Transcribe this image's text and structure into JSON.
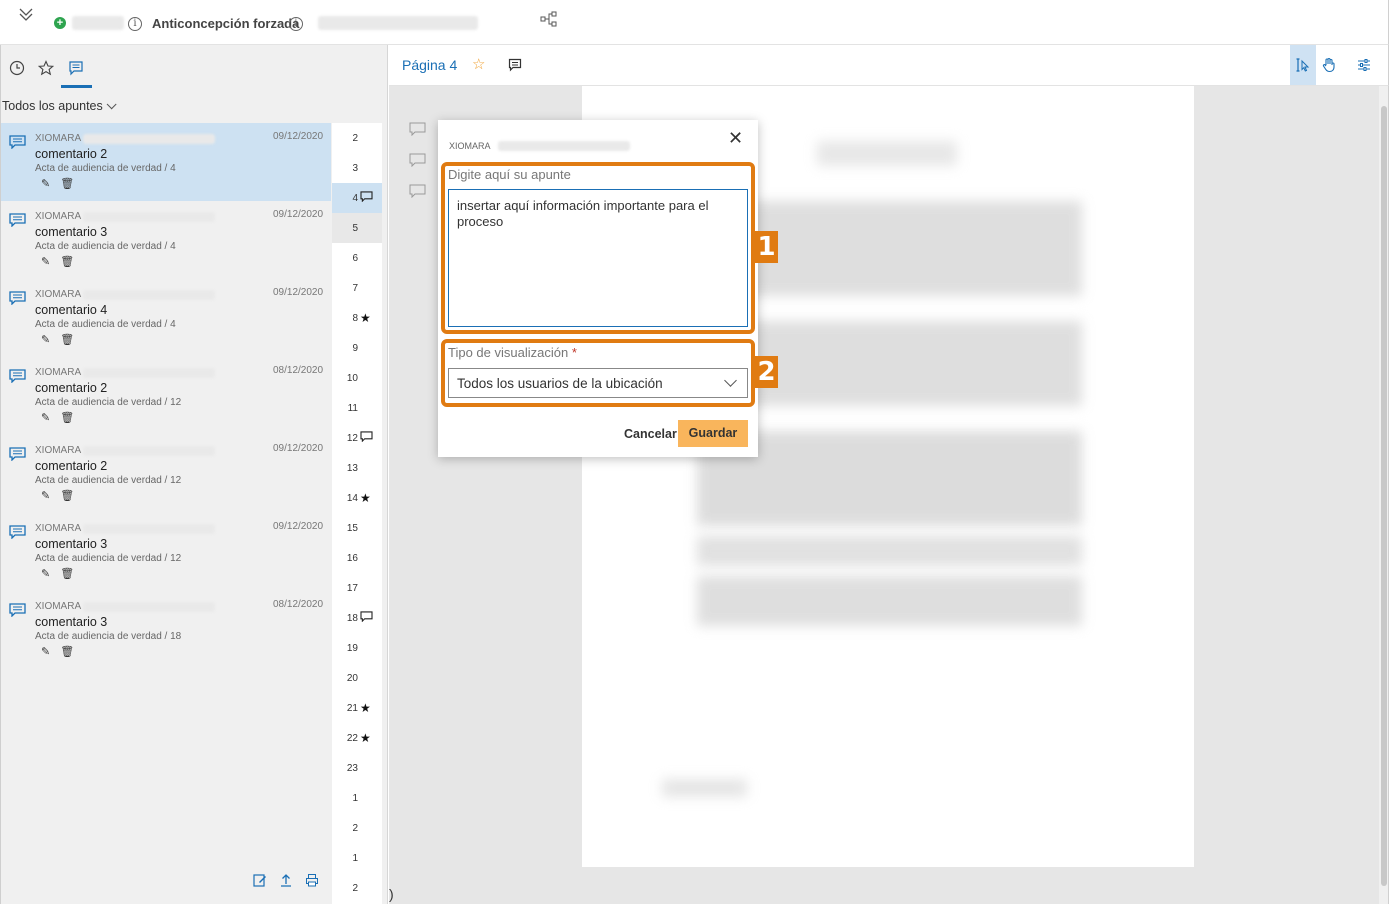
{
  "topbar": {
    "title": "Anticoncepción forzada",
    "info_glyph": "i"
  },
  "left_panel": {
    "filter_label": "Todos los apuntes",
    "notes": [
      {
        "user": "XIOMARA",
        "date": "09/12/2020",
        "title": "comentario 2",
        "doc": "Acta de audiencia de verdad / 4"
      },
      {
        "user": "XIOMARA",
        "date": "09/12/2020",
        "title": "comentario 3",
        "doc": "Acta de audiencia de verdad / 4"
      },
      {
        "user": "XIOMARA",
        "date": "09/12/2020",
        "title": "comentario 4",
        "doc": "Acta de audiencia de verdad / 4"
      },
      {
        "user": "XIOMARA",
        "date": "08/12/2020",
        "title": "comentario 2",
        "doc": "Acta de audiencia de verdad / 12"
      },
      {
        "user": "XIOMARA",
        "date": "09/12/2020",
        "title": "comentario 2",
        "doc": "Acta de audiencia de verdad / 12"
      },
      {
        "user": "XIOMARA",
        "date": "09/12/2020",
        "title": "comentario 3",
        "doc": "Acta de audiencia de verdad / 12"
      },
      {
        "user": "XIOMARA",
        "date": "08/12/2020",
        "title": "comentario 3",
        "doc": "Acta de audiencia de verdad / 18"
      }
    ],
    "pages": [
      {
        "n": "2",
        "mark": ""
      },
      {
        "n": "3",
        "mark": ""
      },
      {
        "n": "4",
        "mark": "comment"
      },
      {
        "n": "5",
        "mark": ""
      },
      {
        "n": "6",
        "mark": ""
      },
      {
        "n": "7",
        "mark": ""
      },
      {
        "n": "8",
        "mark": "star"
      },
      {
        "n": "9",
        "mark": ""
      },
      {
        "n": "10",
        "mark": ""
      },
      {
        "n": "11",
        "mark": ""
      },
      {
        "n": "12",
        "mark": "comment"
      },
      {
        "n": "13",
        "mark": ""
      },
      {
        "n": "14",
        "mark": "star"
      },
      {
        "n": "15",
        "mark": ""
      },
      {
        "n": "16",
        "mark": ""
      },
      {
        "n": "17",
        "mark": ""
      },
      {
        "n": "18",
        "mark": "comment"
      },
      {
        "n": "19",
        "mark": ""
      },
      {
        "n": "20",
        "mark": ""
      },
      {
        "n": "21",
        "mark": "star"
      },
      {
        "n": "22",
        "mark": "star"
      },
      {
        "n": "23",
        "mark": ""
      },
      {
        "n": "1",
        "mark": ""
      },
      {
        "n": "2",
        "mark": ""
      },
      {
        "n": "1",
        "mark": ""
      },
      {
        "n": "2",
        "mark": ""
      }
    ]
  },
  "viewer": {
    "page_title": "Página 4",
    "trailing_char": ")"
  },
  "dialog": {
    "user": "XIOMARA",
    "note_label": "Digite aquí su apunte",
    "note_value": "insertar aquí información importante para el proceso",
    "visibility_label": "Tipo de visualización",
    "required_mark": "*",
    "visibility_value": "Todos los usuarios de la ubicación",
    "cancel_label": "Cancelar",
    "save_label": "Guardar"
  },
  "annotations": {
    "badge1": "1",
    "badge2": "2"
  },
  "colors": {
    "accent": "#1a6fb5",
    "selected_bg": "#cde1f2",
    "save_button": "#f9b55c",
    "annotation": "#e07b12",
    "star": "#f0a030"
  }
}
